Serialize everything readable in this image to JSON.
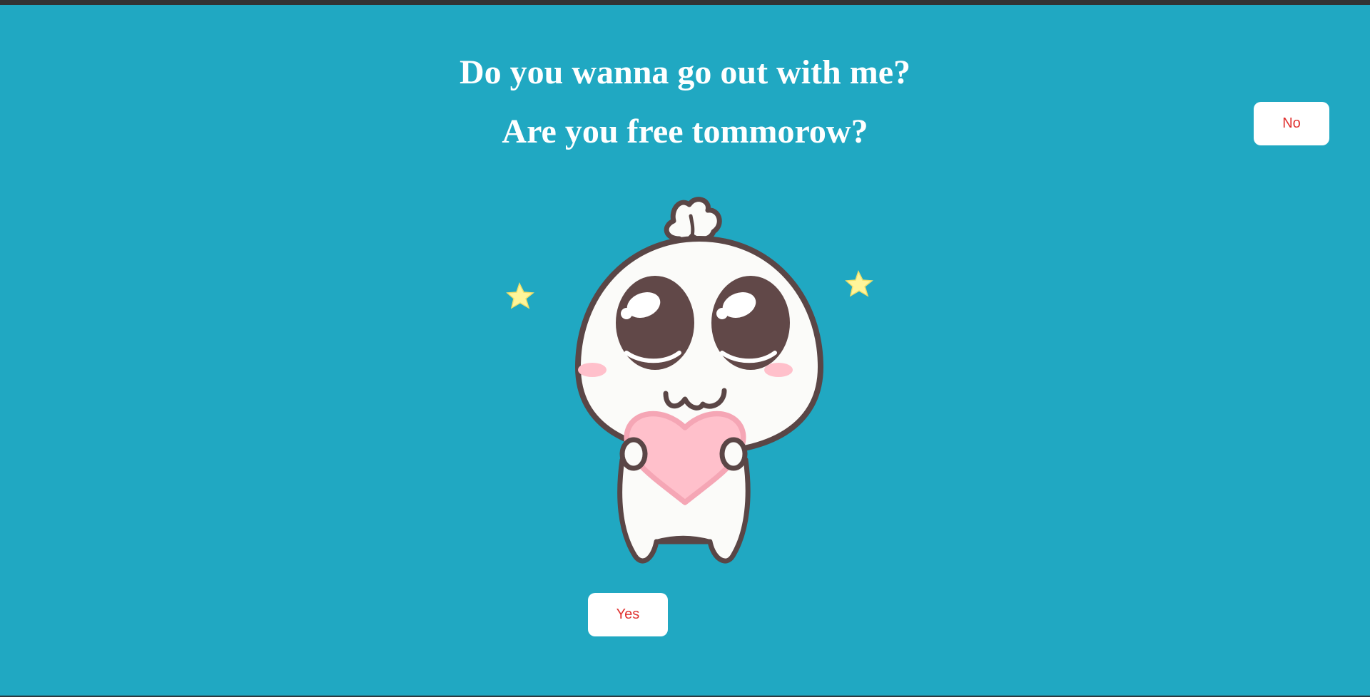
{
  "page": {
    "background_color": "#20a8c2",
    "top_bar_color": "#333333"
  },
  "questions": {
    "line1": "Do you wanna go out with me?",
    "line2": "Are you free tommorow?"
  },
  "buttons": {
    "yes_label": "Yes",
    "no_label": "No",
    "label_color": "#e0312f"
  },
  "illustration": {
    "icon": "cute-mascot-holding-heart-icon",
    "heart_color": "#ffc0cb",
    "star_color": "#fff59a"
  }
}
